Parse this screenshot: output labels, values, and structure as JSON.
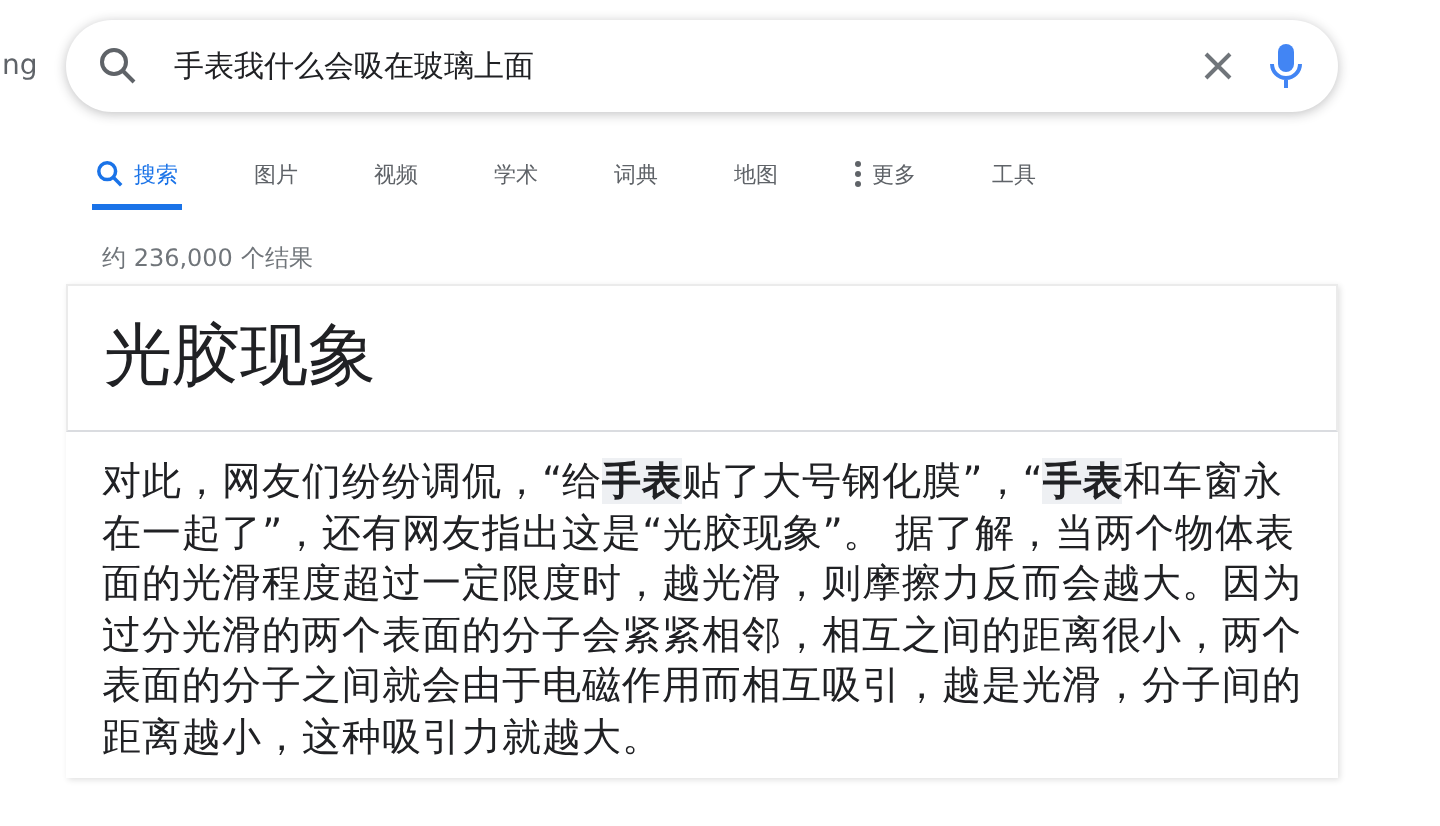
{
  "logo_fragment": "ng",
  "search": {
    "value": "手表我什么会吸在玻璃上面"
  },
  "tabs": [
    {
      "label": "搜索",
      "selected": true,
      "kind": "search"
    },
    {
      "label": "图片",
      "selected": false,
      "kind": "plain"
    },
    {
      "label": "视频",
      "selected": false,
      "kind": "plain"
    },
    {
      "label": "学术",
      "selected": false,
      "kind": "plain"
    },
    {
      "label": "词典",
      "selected": false,
      "kind": "plain"
    },
    {
      "label": "地图",
      "selected": false,
      "kind": "plain"
    },
    {
      "label": "更多",
      "selected": false,
      "kind": "more"
    },
    {
      "label": "工具",
      "selected": false,
      "kind": "plain"
    }
  ],
  "result_count": "约 236,000 个结果",
  "answer": {
    "title": "光胶现象",
    "text": "对此，网友们纷纷调侃，“给**手表**贴了大号钢化膜”，“**手表**和车窗永在一起了”，还有网友指出这是“光胶现象”。 据了解，当两个物体表面的光滑程度超过一定限度时，越光滑，则摩擦力反而会越大。因为过分光滑的两个表面的分子会紧紧相邻，相互之间的距离很小，两个表面的分子之间就会由于电磁作用而相互吸引，越是光滑，分子间的距离越小，这种吸引力就越大。"
  }
}
